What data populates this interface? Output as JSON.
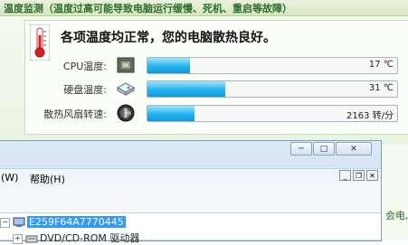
{
  "monitor": {
    "title": "温度监测（温度过高可能导致电脑运行缓慢、死机、重启等故障）",
    "status_message": "各项温度均正常，您的电脑散热良好。",
    "rows": [
      {
        "label": "CPU温度:",
        "value_text": "17 ℃",
        "fill_fraction": 0.17
      },
      {
        "label": "硬盘温度:",
        "value_text": "31 ℃",
        "fill_fraction": 0.31
      },
      {
        "label": "散热风扇转速:",
        "value_text": "2163 转/分",
        "fill_fraction": 0.19
      }
    ]
  },
  "window": {
    "menu_items": [
      "(W)",
      "帮助(H)"
    ],
    "tree": {
      "root_label": "E259F64A7770445",
      "child_label": "DVD/CD-ROM 驱动器"
    },
    "side_text": "会电,"
  },
  "colors": {
    "accent_green": "#2c6d2c",
    "progress_blue": "#24b2ec",
    "selection_blue": "#3399ff"
  },
  "icons": {
    "status": "thermometer-icon",
    "cpu": "cpu-chip-icon",
    "disk": "hard-disk-icon",
    "fan": "fan-icon",
    "root": "computer-icon",
    "child": "dvd-drive-icon"
  }
}
